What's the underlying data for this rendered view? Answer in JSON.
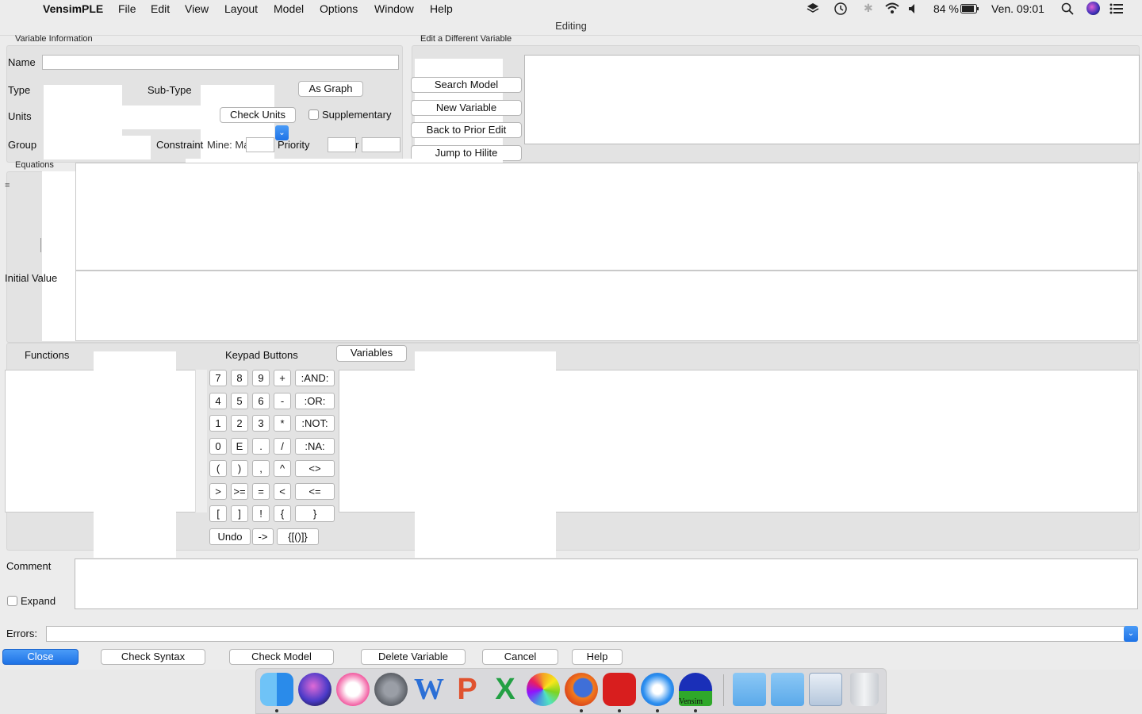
{
  "menubar": {
    "app": "VensimPLE",
    "items": [
      "File",
      "Edit",
      "View",
      "Layout",
      "Model",
      "Options",
      "Window",
      "Help"
    ],
    "battery": "84 %",
    "clock": "Ven. 09:01"
  },
  "window": {
    "title": "Editing"
  },
  "variable_info": {
    "group_label": "Variable Information",
    "name_label": "Name",
    "name_value": "",
    "type_label": "Type",
    "subtype_label": "Sub-Type",
    "as_graph": "As Graph",
    "units_label": "Units",
    "check_units": "Check Units",
    "supplementary": "Supplementary",
    "group_field_label": "Group",
    "constraint_label": "Constraint",
    "overlap_text": "Mine: Max",
    "priority_label": "Priority",
    "r_label": "r"
  },
  "edit_different": {
    "group_label": "Edit a Different Variable",
    "search_model": "Search Model",
    "new_variable": "New Variable",
    "back_prior": "Back to Prior Edit",
    "jump_hilite": "Jump to Hilite"
  },
  "equations": {
    "group_label": "Equations",
    "equals": "=",
    "initial_value_label": "Initial Value"
  },
  "functions": {
    "label": "Functions"
  },
  "keypad": {
    "label": "Keypad Buttons",
    "variables_btn": "Variables",
    "rows": [
      [
        "7",
        "8",
        "9",
        "+",
        ":AND:"
      ],
      [
        "4",
        "5",
        "6",
        "-",
        ":OR:"
      ],
      [
        "1",
        "2",
        "3",
        "*",
        ":NOT:"
      ],
      [
        "0",
        "E",
        ".",
        "/",
        ":NA:"
      ],
      [
        "(",
        ")",
        ",",
        "^",
        "<>"
      ],
      [
        ">",
        ">=",
        "=",
        "<",
        "<="
      ],
      [
        "[",
        "]",
        "!",
        "{",
        "}"
      ]
    ],
    "undo": "Undo",
    "arrow": "->",
    "brackets": "{[()]}"
  },
  "comment": {
    "label": "Comment",
    "expand": "Expand"
  },
  "errors": {
    "label": "Errors:"
  },
  "footer": {
    "close": "Close",
    "check_syntax": "Check Syntax",
    "check_model": "Check Model",
    "delete_variable": "Delete Variable",
    "cancel": "Cancel",
    "help": "Help"
  },
  "dock": {
    "icons": [
      "finder-icon",
      "siri-icon",
      "itunes-icon",
      "system-preferences-icon",
      "word-icon",
      "powerpoint-icon",
      "excel-icon",
      "photos-icon",
      "firefox-icon",
      "acrobat-icon",
      "safari-icon",
      "vensim-icon",
      "applications-folder-icon",
      "documents-folder-icon",
      "preview-icon",
      "trash-icon"
    ],
    "vensim_label": "Vensim"
  }
}
